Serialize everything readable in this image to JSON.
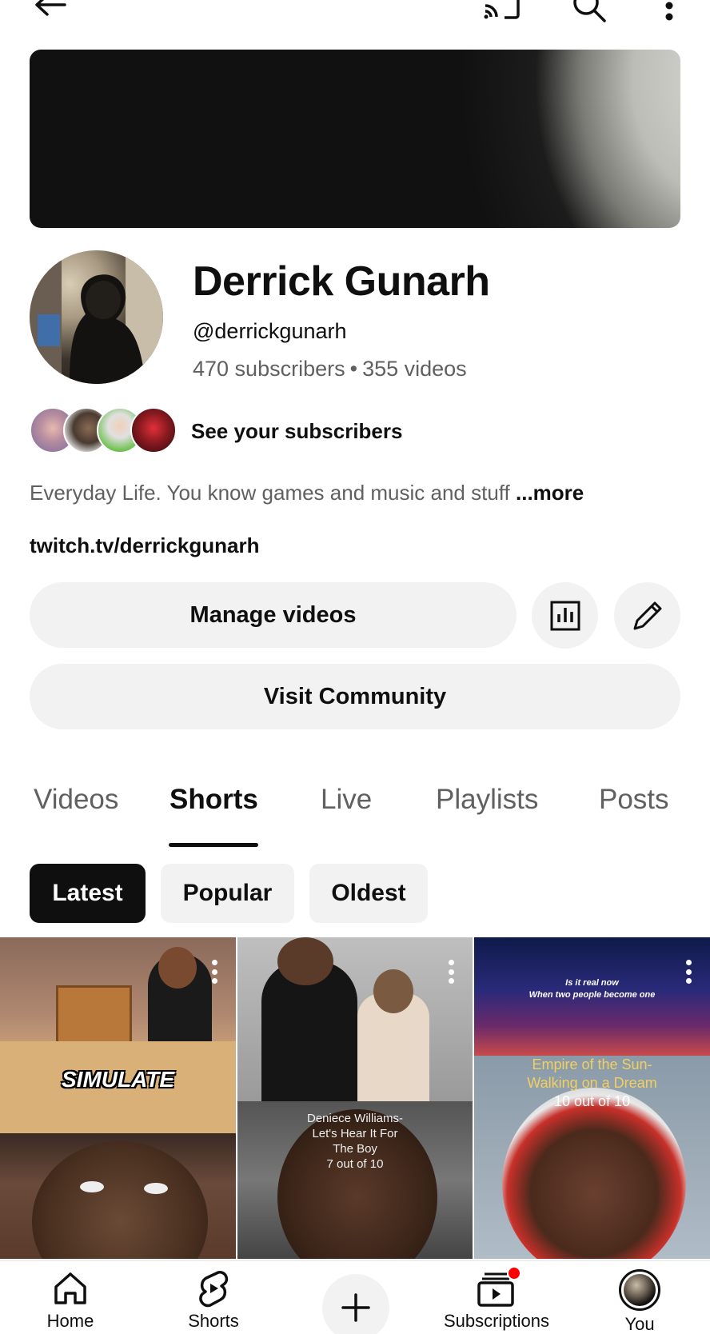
{
  "channel": {
    "name": "Derrick Gunarh",
    "handle": "@derrickgunarh",
    "subscribers": "470 subscribers",
    "separator": "•",
    "videos": "355 videos",
    "see_subscribers": "See your subscribers",
    "description": "Everyday Life. You know games and music and stuff ",
    "description_more": "...more",
    "link": "twitch.tv/derrickgunarh"
  },
  "actions": {
    "manage_videos": "Manage videos",
    "visit_community": "Visit Community"
  },
  "tabs": [
    {
      "label": "Videos",
      "active": false
    },
    {
      "label": "Shorts",
      "active": true
    },
    {
      "label": "Live",
      "active": false
    },
    {
      "label": "Playlists",
      "active": false
    },
    {
      "label": "Posts",
      "active": false
    }
  ],
  "chips": [
    {
      "label": "Latest",
      "active": true
    },
    {
      "label": "Popular",
      "active": false
    },
    {
      "label": "Oldest",
      "active": false
    }
  ],
  "shorts": [
    {
      "overlay": "SIMULATE"
    },
    {
      "overlay_lines": [
        "Deniece Williams-",
        "Let's Hear It For",
        "The Boy",
        "7 out of 10"
      ]
    },
    {
      "overlay_top": [
        "Is it real now",
        "When two people become one"
      ],
      "overlay_lines": [
        "Empire of the Sun-",
        "Walking on a Dream",
        "10 out of 10"
      ]
    }
  ],
  "bottom_nav": [
    {
      "label": "Home",
      "icon": "home-icon"
    },
    {
      "label": "Shorts",
      "icon": "shorts-icon"
    },
    {
      "label": "",
      "icon": "create-icon"
    },
    {
      "label": "Subscriptions",
      "icon": "subscriptions-icon"
    },
    {
      "label": "You",
      "icon": "you-avatar"
    }
  ],
  "colors": {
    "text_primary": "#0f0f0f",
    "text_secondary": "#606060",
    "button_bg": "#f2f2f2",
    "notification_red": "#ff0000"
  }
}
